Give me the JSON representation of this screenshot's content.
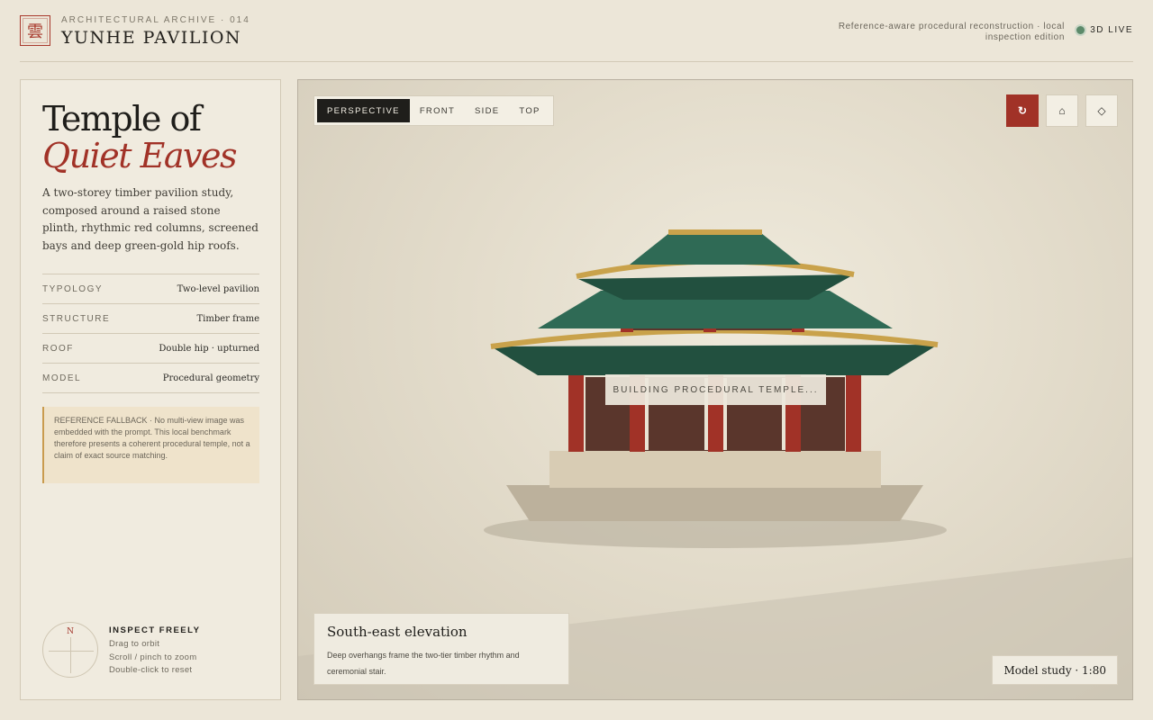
{
  "header": {
    "seal_glyph": "雲",
    "archive_label": "ARCHITECTURAL ARCHIVE · 014",
    "title": "YUNHE PAVILION",
    "note": "Reference-aware procedural reconstruction · local inspection edition",
    "live_label": "3D LIVE"
  },
  "panel": {
    "title_line1": "Temple of",
    "title_line2": "Quiet Eaves",
    "description": "A two-storey timber pavilion study, composed around a raised stone plinth, rhythmic red columns, screened bays and deep green-gold hip roofs.",
    "specs": [
      {
        "key": "TYPOLOGY",
        "value": "Two-level pavilion"
      },
      {
        "key": "STRUCTURE",
        "value": "Timber frame"
      },
      {
        "key": "ROOF",
        "value": "Double hip · upturned"
      },
      {
        "key": "MODEL",
        "value": "Procedural geometry"
      }
    ],
    "fallback_note": "REFERENCE FALLBACK · No multi-view image was embedded with the prompt. This local benchmark therefore presents a coherent procedural temple, not a claim of exact source matching.",
    "compass_label": "N",
    "inspect": {
      "title": "INSPECT FREELY",
      "lines": [
        "Drag to orbit",
        "Scroll / pinch to zoom",
        "Double-click to reset"
      ]
    }
  },
  "viewport": {
    "tabs": [
      {
        "label": "PERSPECTIVE",
        "active": true
      },
      {
        "label": "FRONT",
        "active": false
      },
      {
        "label": "SIDE",
        "active": false
      },
      {
        "label": "TOP",
        "active": false
      }
    ],
    "buttons": [
      {
        "glyph": "↻",
        "name": "auto-rotate-icon"
      },
      {
        "glyph": "⌂",
        "name": "home-icon"
      },
      {
        "glyph": "◇",
        "name": "diamond-icon"
      }
    ],
    "loading_text": "BUILDING PROCEDURAL TEMPLE...",
    "caption_title": "South-east elevation",
    "caption_text": "Deep overhangs frame the two-tier timber rhythm and ceremonial stair.",
    "scale_label": "Model study · 1:80"
  },
  "colors": {
    "accent_red": "#a13227",
    "roof_green": "#2f6a55",
    "roof_gold": "#c9a24b",
    "wall_brown": "#5a362c",
    "background": "#ece6d8"
  }
}
